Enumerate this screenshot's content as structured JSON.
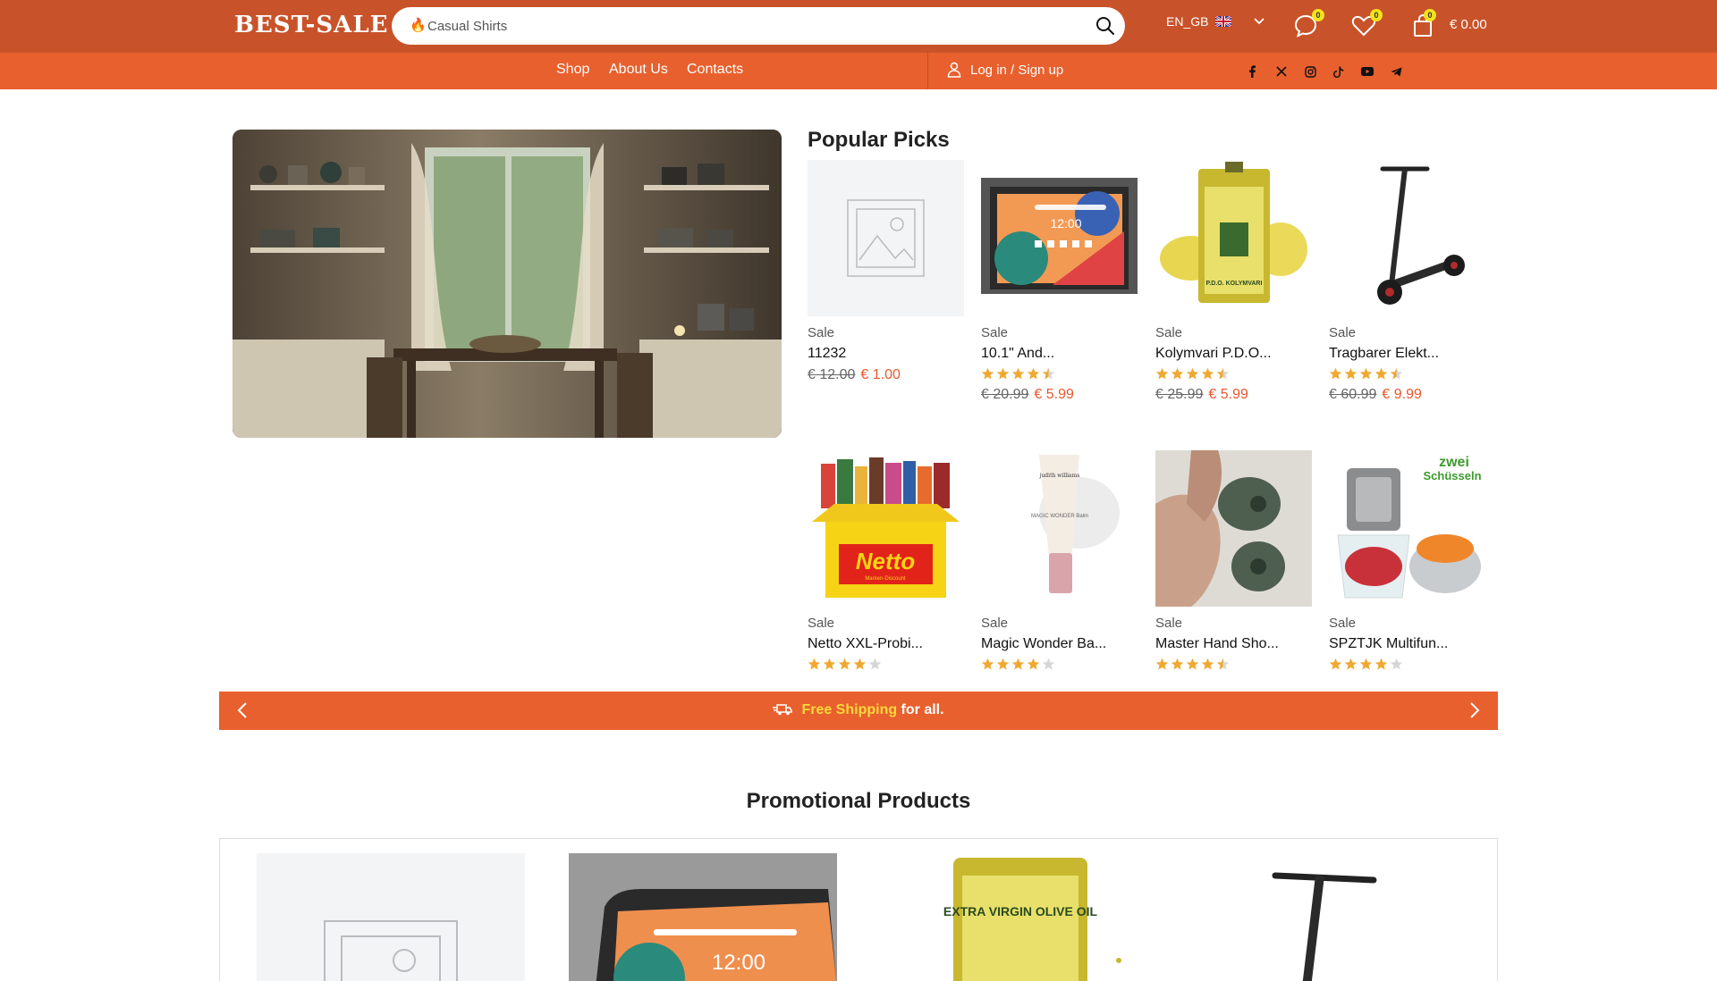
{
  "header": {
    "logo": "BEST-SALE",
    "search_placeholder": "Casual Shirts",
    "language": "EN_GB",
    "messages_count": "0",
    "wishlist_count": "0",
    "cart_count": "0",
    "cart_total": "€ 0.00"
  },
  "nav": {
    "shop": "Shop",
    "about": "About Us",
    "contacts": "Contacts",
    "login": "Log in / Sign up",
    "social": [
      "facebook-icon",
      "x-icon",
      "instagram-icon",
      "tiktok-icon",
      "youtube-icon",
      "telegram-icon"
    ]
  },
  "popular": {
    "title": "Popular Picks",
    "products": [
      {
        "sale": "Sale",
        "name": "11232",
        "old": "€ 12.00",
        "new": "€ 1.00",
        "rating": null
      },
      {
        "sale": "Sale",
        "name": "10.1\" And...",
        "old": "€ 20.99",
        "new": "€ 5.99",
        "rating": 4.5
      },
      {
        "sale": "Sale",
        "name": "Kolymvari P.D.O...",
        "old": "€ 25.99",
        "new": "€ 5.99",
        "rating": 4.5
      },
      {
        "sale": "Sale",
        "name": "Tragbarer Elekt...",
        "old": "€ 60.99",
        "new": "€ 9.99",
        "rating": 4.5
      },
      {
        "sale": "Sale",
        "name": "Netto XXL-Probi...",
        "rating": 4.0
      },
      {
        "sale": "Sale",
        "name": "Magic Wonder Ba...",
        "rating": 4.0
      },
      {
        "sale": "Sale",
        "name": "Master Hand Sho...",
        "rating": 4.5
      },
      {
        "sale": "Sale",
        "name": "SPZTJK Multifun...",
        "rating": 4.0
      }
    ]
  },
  "image_text": {
    "tablet_clock": "12:00",
    "oil_label": "P.D.O. KOLYMVARI",
    "oil_can": "EXTRA VIRGIN OLIVE OIL",
    "netto_logo": "Netto",
    "netto_sub": "Marken-Discount",
    "balm_brand": "judith williams",
    "balm_name": "MAGIC WONDER Balm",
    "chopper_label_1": "zwei",
    "chopper_label_2": "Schüsseln"
  },
  "shipping": {
    "highlight": "Free Shipping",
    "rest": " for all."
  },
  "promo": {
    "title": "Promotional Products"
  },
  "colors": {
    "topbar": "#c8532a",
    "navbar": "#e8602e",
    "price_new": "#e8572d",
    "badge": "#f4e21c",
    "star": "#f0a830"
  }
}
